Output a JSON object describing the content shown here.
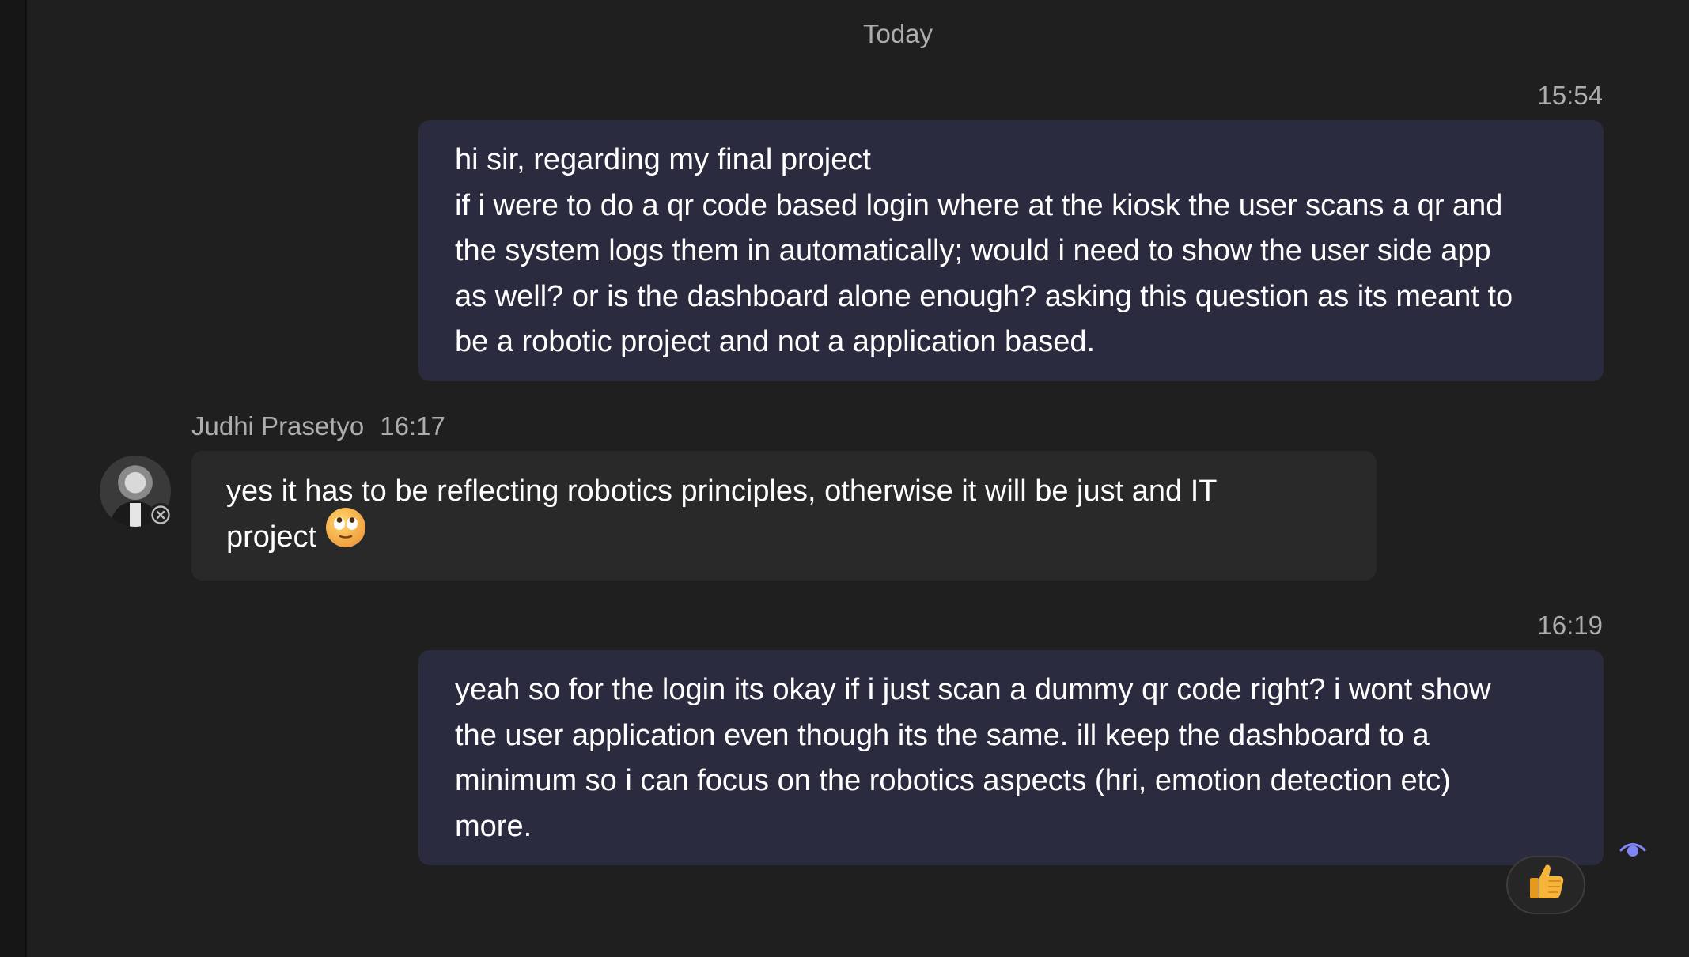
{
  "conversation": {
    "date_divider": "Today"
  },
  "messages": [
    {
      "direction": "outgoing",
      "time": "15:54",
      "lines": [
        "hi sir, regarding my final project",
        "if i were to do a qr code based login where at the kiosk the user scans a qr and",
        "the system logs them in automatically; would i need to show the user side app",
        "as well? or is the dashboard alone enough? asking this question as its meant to",
        "be a robotic project and not a application based."
      ]
    },
    {
      "direction": "incoming",
      "sender": "Judhi Prasetyo",
      "time": "16:17",
      "lines": [
        "yes it has to be reflecting robotics principles, otherwise it will be just and IT",
        "project"
      ],
      "emoji": "face-with-rolling-eyes-icon"
    },
    {
      "direction": "outgoing",
      "time": "16:19",
      "lines": [
        "yeah so for the login its okay if i just scan a dummy qr code right? i wont show",
        "the user application even though its the same. ill keep the dashboard to a",
        "minimum so i can focus on the robotics aspects (hri, emotion detection etc)",
        "more."
      ],
      "reaction": "thumbs-up-icon",
      "status": "seen-icon"
    }
  ],
  "colors": {
    "background": "#1f1f1f",
    "outgoing_bubble": "#2b2b40",
    "incoming_bubble": "#292929",
    "muted_text": "#adadad",
    "accent": "#7f85f5"
  }
}
